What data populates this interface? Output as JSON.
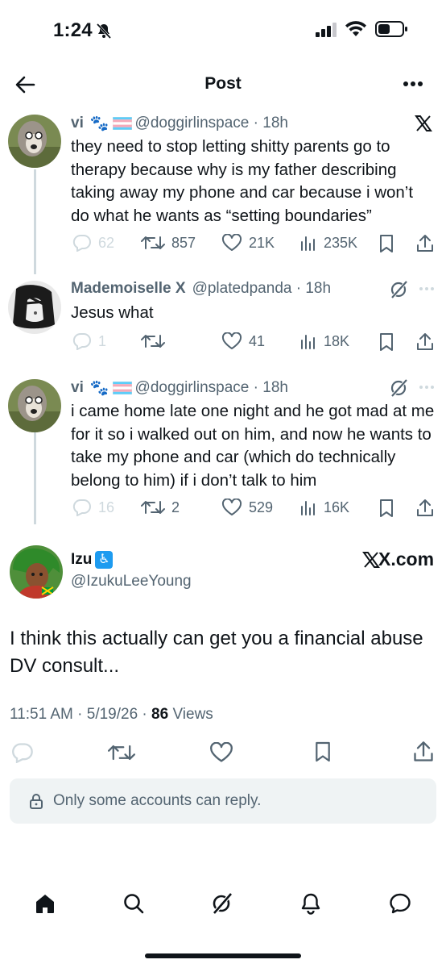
{
  "status_bar": {
    "time": "1:24"
  },
  "header": {
    "title": "Post"
  },
  "tweets": [
    {
      "name": "vi",
      "handle": "@doggirlinspace",
      "time": "18h",
      "text": "they need to stop letting shitty parents go to therapy because why is my father describing taking away my phone and car because i won’t do what he wants as “setting boundaries”",
      "replies": "62",
      "retweets": "857",
      "likes": "21K",
      "views": "235K"
    },
    {
      "name": "Mademoiselle X",
      "handle": "@platedpanda",
      "time": "18h",
      "text": "Jesus what",
      "replies": "1",
      "retweets": "",
      "likes": "41",
      "views": "18K"
    },
    {
      "name": "vi",
      "handle": "@doggirlinspace",
      "time": "18h",
      "text": "i came home late one night and he got mad at me for it so i walked out on him, and now he wants to take my phone and car (which do technically belong to him) if i don’t talk to him",
      "replies": "16",
      "retweets": "2",
      "likes": "529",
      "views": "16K"
    }
  ],
  "main_post": {
    "name": "Izu",
    "handle": "@IzukuLeeYoung",
    "site": "X.com",
    "text": "I think this actually can get you a financial abuse DV consult...",
    "timestamp": "11:51 AM · 5/19/26 ·",
    "views_count": "86",
    "views_label": "Views"
  },
  "reply_notice": "Only some accounts can reply.",
  "colors": {
    "text": "#0f1419",
    "muted": "#536471",
    "line": "#cfd9de",
    "reply_bg": "#eff3f4"
  }
}
